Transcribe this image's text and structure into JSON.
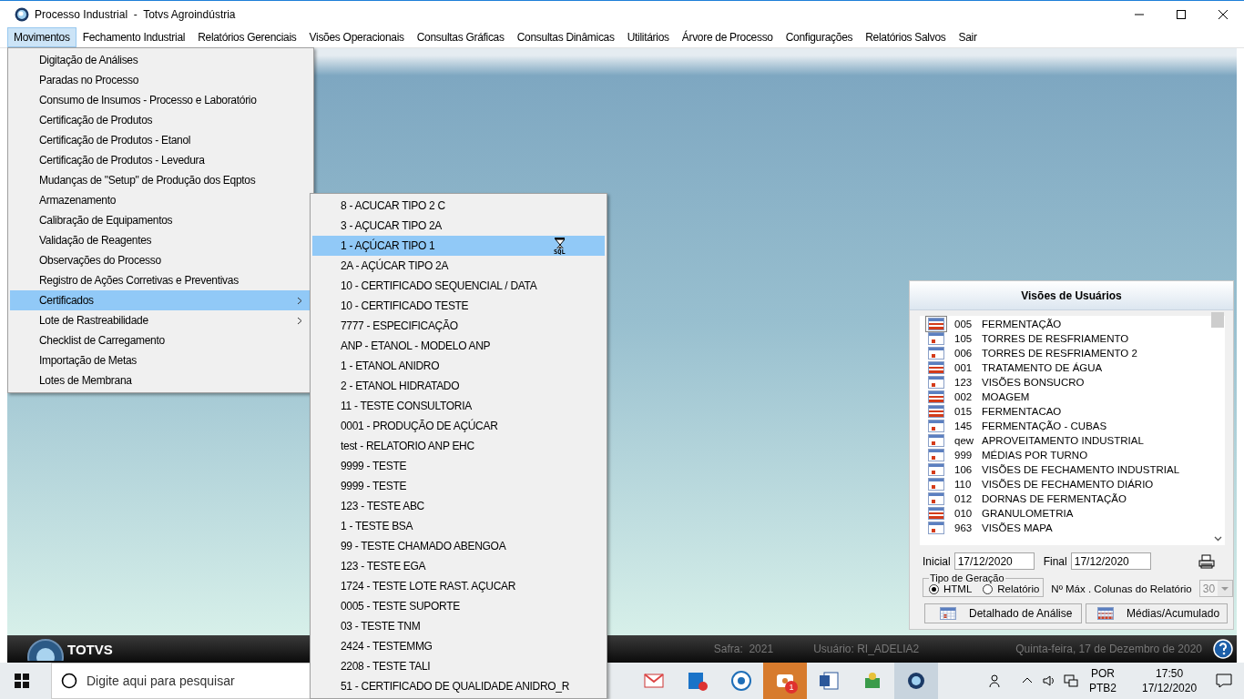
{
  "window": {
    "title": "Processo Industrial  -  Totvs Agroindústria"
  },
  "menubar": [
    {
      "label": "Movimentos",
      "selected": true
    },
    {
      "label": "Fechamento Industrial",
      "selected": false
    },
    {
      "label": "Relatórios Gerenciais",
      "selected": false
    },
    {
      "label": "Visões Operacionais",
      "selected": false
    },
    {
      "label": "Consultas Gráficas",
      "selected": false
    },
    {
      "label": "Consultas Dinâmicas",
      "selected": false
    },
    {
      "label": "Utilitários",
      "selected": false
    },
    {
      "label": "Árvore de Processo",
      "selected": false
    },
    {
      "label": "Configurações",
      "selected": false
    },
    {
      "label": "Relatórios Salvos",
      "selected": false
    },
    {
      "label": "Sair",
      "selected": false
    }
  ],
  "menu": [
    {
      "label": "Digitação de Análises",
      "selected": false,
      "submenu": false
    },
    {
      "label": "Paradas no Processo",
      "selected": false,
      "submenu": false
    },
    {
      "label": "Consumo de Insumos - Processo e Laboratório",
      "selected": false,
      "submenu": false
    },
    {
      "label": "Certificação de Produtos",
      "selected": false,
      "submenu": false
    },
    {
      "label": "Certificação de Produtos  - Etanol",
      "selected": false,
      "submenu": false
    },
    {
      "label": "Certificação de Produtos  - Levedura",
      "selected": false,
      "submenu": false
    },
    {
      "label": "Mudanças de \"Setup\" de Produção dos Eqptos",
      "selected": false,
      "submenu": false
    },
    {
      "label": "Armazenamento",
      "selected": false,
      "submenu": false
    },
    {
      "label": "Calibração de Equipamentos",
      "selected": false,
      "submenu": false
    },
    {
      "label": "Validação de Reagentes",
      "selected": false,
      "submenu": false
    },
    {
      "label": "Observações do Processo",
      "selected": false,
      "submenu": false
    },
    {
      "label": "Registro de Ações Corretivas e Preventivas",
      "selected": false,
      "submenu": false
    },
    {
      "label": "Certificados",
      "selected": true,
      "submenu": true
    },
    {
      "label": "Lote de Rastreabilidade",
      "selected": false,
      "submenu": true
    },
    {
      "label": "Checklist de Carregamento",
      "selected": false,
      "submenu": false
    },
    {
      "label": "Importação de Metas",
      "selected": false,
      "submenu": false
    },
    {
      "label": "Lotes de Membrana",
      "selected": false,
      "submenu": false
    }
  ],
  "submenu": [
    {
      "label": "8 - ACUCAR TIPO 2 C",
      "selected": false
    },
    {
      "label": "3 - AÇUCAR TIPO 2A",
      "selected": false
    },
    {
      "label": "1 - AÇÚCAR TIPO 1",
      "selected": true
    },
    {
      "label": "2A - AÇÚCAR TIPO 2A",
      "selected": false
    },
    {
      "label": "10 - CERTIFICADO SEQUENCIAL / DATA",
      "selected": false
    },
    {
      "label": "10 - CERTIFICADO TESTE",
      "selected": false
    },
    {
      "label": "7777 - ESPECIFICAÇÃO",
      "selected": false
    },
    {
      "label": "ANP - ETANOL - MODELO ANP",
      "selected": false
    },
    {
      "label": "1 - ETANOL ANIDRO",
      "selected": false
    },
    {
      "label": "2 - ETANOL HIDRATADO",
      "selected": false
    },
    {
      "label": "11 - TESTE CONSULTORIA",
      "selected": false
    },
    {
      "label": "0001 - PRODUÇÃO DE AÇÚCAR",
      "selected": false
    },
    {
      "label": "test - RELATORIO ANP EHC",
      "selected": false
    },
    {
      "label": "9999 - TESTE",
      "selected": false
    },
    {
      "label": "9999 - TESTE",
      "selected": false
    },
    {
      "label": "123 - TESTE ABC",
      "selected": false
    },
    {
      "label": "1 - TESTE BSA",
      "selected": false
    },
    {
      "label": "99 - TESTE CHAMADO ABENGOA",
      "selected": false
    },
    {
      "label": "123 - TESTE EGA",
      "selected": false
    },
    {
      "label": "1724 - TESTE LOTE RAST. AÇUCAR",
      "selected": false
    },
    {
      "label": "0005 - TESTE SUPORTE",
      "selected": false
    },
    {
      "label": "03 - TESTE TNM",
      "selected": false
    },
    {
      "label": "2424 - TESTEMMG",
      "selected": false
    },
    {
      "label": "2208 - TESTE TALI",
      "selected": false
    },
    {
      "label": "51 - CERTIFICADO DE QUALIDADE ANIDRO_R",
      "selected": false
    }
  ],
  "cursor": {
    "label": "SQL"
  },
  "panel": {
    "title": "Visões de Usuários",
    "views": [
      {
        "code": "005",
        "name": "FERMENTAÇÃO",
        "kind": "full",
        "focused": true
      },
      {
        "code": "105",
        "name": "TORRES DE RESFRIAMENTO",
        "kind": "cell",
        "focused": false
      },
      {
        "code": "006",
        "name": "TORRES DE RESFRIAMENTO 2",
        "kind": "cell",
        "focused": false
      },
      {
        "code": "001",
        "name": "TRATAMENTO DE ÁGUA",
        "kind": "full",
        "focused": false
      },
      {
        "code": "123",
        "name": "VISÕES BONSUCRO",
        "kind": "cell",
        "focused": false
      },
      {
        "code": "002",
        "name": "MOAGEM",
        "kind": "full",
        "focused": false
      },
      {
        "code": "015",
        "name": "FERMENTACAO",
        "kind": "full",
        "focused": false
      },
      {
        "code": "145",
        "name": "FERMENTAÇÃO - CUBAS",
        "kind": "cell",
        "focused": false
      },
      {
        "code": "qew",
        "name": "APROVEITAMENTO INDUSTRIAL",
        "kind": "cell",
        "focused": false
      },
      {
        "code": "999",
        "name": "MÉDIAS POR TURNO",
        "kind": "cell",
        "focused": false
      },
      {
        "code": "106",
        "name": "VISÕES DE FECHAMENTO INDUSTRIAL",
        "kind": "cell",
        "focused": false
      },
      {
        "code": "110",
        "name": "VISÕES DE FECHAMENTO DIÁRIO",
        "kind": "cell",
        "focused": false
      },
      {
        "code": "012",
        "name": "DORNAS DE FERMENTAÇÃO",
        "kind": "cell",
        "focused": false
      },
      {
        "code": "010",
        "name": "GRANULOMETRIA",
        "kind": "full",
        "focused": false
      },
      {
        "code": "963",
        "name": "VISÕES MAPA",
        "kind": "cell",
        "focused": false
      }
    ],
    "start": {
      "label": "Inicial",
      "value": "17/12/2020"
    },
    "end": {
      "label": "Final",
      "value": "17/12/2020"
    },
    "generation": {
      "label": "Tipo de Geração",
      "options": [
        {
          "label": "HTML",
          "selected": true
        },
        {
          "label": "Relatório",
          "selected": false
        }
      ]
    },
    "max_columns": {
      "label": "Nº Máx . Colunas do Relatório",
      "value": "30",
      "disabled": true
    },
    "buttons": [
      {
        "label": "Detalhado de Análise",
        "kind": "cell"
      },
      {
        "label": "Médias/Acumulado",
        "kind": "full"
      }
    ]
  },
  "status_bar": {
    "logo": "TOTVS",
    "safra": "Safra:  2021",
    "user": "Usuário: RI_ADELIA2",
    "date": "Quinta-feira, 17 de Dezembro de 2020"
  },
  "taskbar": {
    "search_placeholder": "Digite aqui para pesquisar",
    "badge": "1",
    "language": "POR",
    "layout": "PTB2",
    "time": "17:50",
    "date": "17/12/2020"
  }
}
